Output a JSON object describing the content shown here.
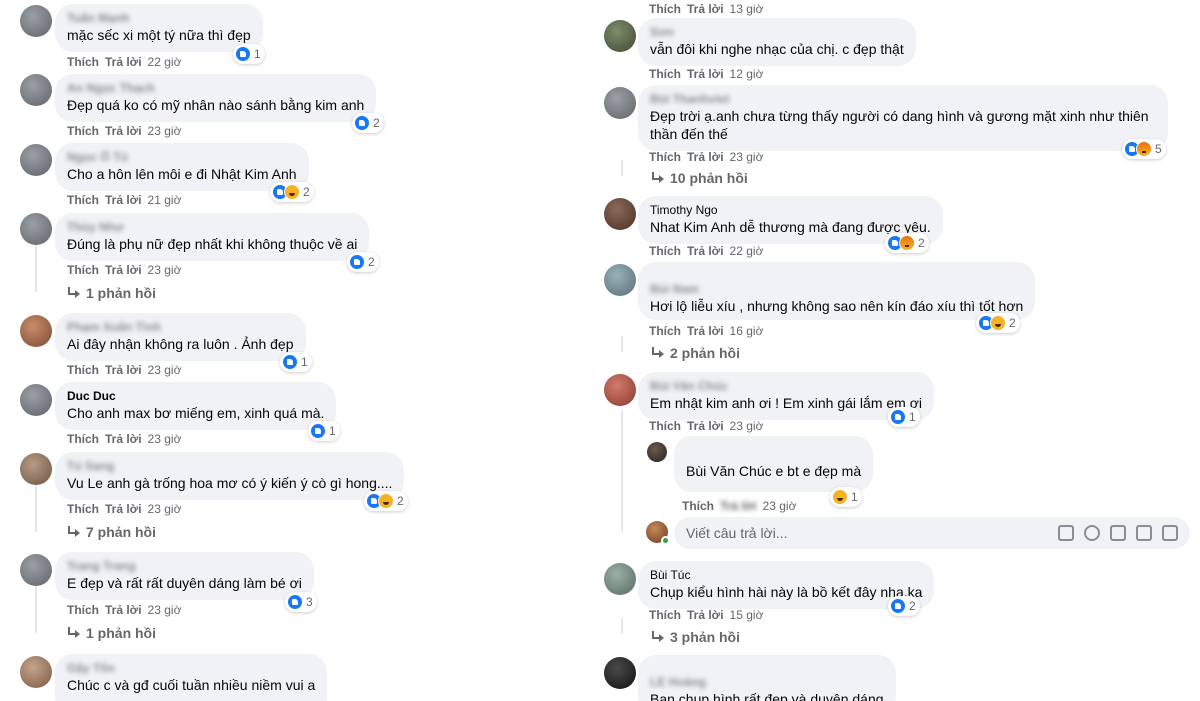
{
  "actions": {
    "like": "Thích",
    "reply": "Trả lời"
  },
  "left_comments": [
    {
      "author": "Tuấn Mạnh",
      "text": "mặc sếc xi một tý nữa thì đẹp",
      "time": "22 giờ",
      "reactions": [
        "like"
      ],
      "count": "1"
    },
    {
      "author": "An Ngọc Thạch",
      "text": "Đẹp quá ko có mỹ nhân nào sánh bằng kim anh",
      "time": "23 giờ",
      "reactions": [
        "like"
      ],
      "count": "2"
    },
    {
      "author": "Ngọc Ổ Tú",
      "text": "Cho a hôn lên môi e đi Nhật Kim Anh",
      "time": "21 giờ",
      "reactions": [
        "like",
        "haha"
      ],
      "count": "2"
    },
    {
      "author": "Thùy Như",
      "text": "Đúng là phụ nữ đẹp nhất khi không thuộc về ai",
      "time": "23 giờ",
      "reactions": [
        "like"
      ],
      "count": "2",
      "replies": "1 phản hồi"
    },
    {
      "author": "Phạm Xuân Tình",
      "text": "Ai đây nhận không ra luôn . Ảnh đẹp",
      "time": "23 giờ",
      "reactions": [
        "like"
      ],
      "count": "1"
    },
    {
      "author": "Duc Duc",
      "text": "Cho anh max bơ miếng em, xinh quá mà.",
      "time": "23 giờ",
      "reactions": [
        "like"
      ],
      "count": "1"
    },
    {
      "author": "Tú Sang",
      "text": "Vu Le anh gà trống hoa mơ có ý kiến ý cò gì hong....",
      "time": "23 giờ",
      "reactions": [
        "like",
        "haha"
      ],
      "count": "2",
      "replies": "7 phản hồi"
    },
    {
      "author": "Trang Trang",
      "text": "E đẹp và rất rất duyên dáng làm bé ơi",
      "time": "23 giờ",
      "reactions": [
        "like"
      ],
      "count": "3",
      "replies": "1 phản hồi"
    },
    {
      "author": "Gậy Tôn",
      "text": "Chúc c và gđ cuối tuần nhiều niềm vui a"
    }
  ],
  "right_comments": [
    {
      "author": "Sơn",
      "text": "vẫn đôi khi nghe nhạc của chị. c đẹp thật",
      "time": "12 giờ"
    },
    {
      "author": "Bùi Thanhviet",
      "text": "Đẹp trời ạ.anh chưa từng thấy người có dang hình và gương mặt xinh như thiên thần đến thế",
      "time": "23 giờ",
      "reactions": [
        "like",
        "angry"
      ],
      "count": "5",
      "replies": "10 phản hồi"
    },
    {
      "author": "Timothy Ngo",
      "text": "Nhat Kim Anh dễ thương mà đang được yêu.",
      "time": "22 giờ",
      "reactions": [
        "like",
        "angry"
      ],
      "count": "2"
    },
    {
      "author": "Bùi Nam",
      "text": "Hơi lộ liễu xíu , nhưng không sao nên kín đáo xíu thì tốt hơn",
      "time": "16 giờ",
      "reactions": [
        "like",
        "haha"
      ],
      "count": "2",
      "replies": "2 phản hồi"
    },
    {
      "author": "Bùi Văn Chúc",
      "text": "Em nhật kim anh ơi ! Em xinh gái lắm em ơi",
      "time": "23 giờ",
      "reactions": [
        "like"
      ],
      "count": "1"
    },
    {
      "author": "Bùi Túc",
      "text": "Chụp kiểu hình hài này là bồ kết đây nha,ka",
      "time": "15 giờ",
      "reactions": [
        "like"
      ],
      "count": "2",
      "replies": "3 phản hồi"
    },
    {
      "author": "LE Hoàng",
      "text": "Bạn chụp hình rất đẹp và duyên dáng"
    }
  ],
  "top_meta_time": "13 giờ",
  "nested_reply": {
    "author": "Bùi Văn Chúc",
    "text": "Bùi Văn Chúc e bt e đẹp mà",
    "time": "23 giờ",
    "reactions": [
      "haha"
    ],
    "count": "1"
  },
  "reply_box": {
    "placeholder": "Viết câu trả lời..."
  }
}
